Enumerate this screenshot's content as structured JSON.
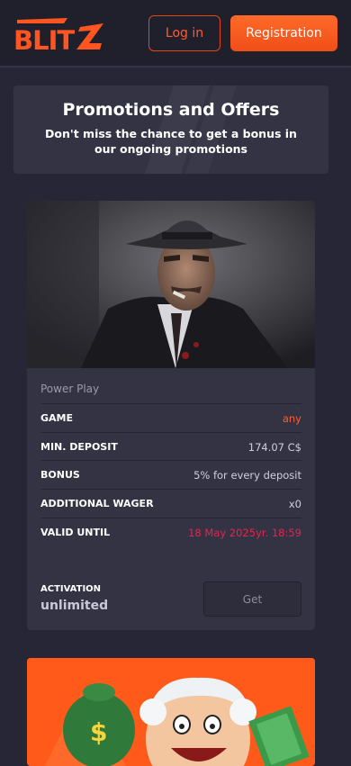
{
  "header": {
    "logo_text": "BLITZ",
    "login_label": "Log in",
    "register_label": "Registration"
  },
  "promotions": {
    "title": "Promotions and Offers",
    "subtitle": "Don't miss the chance to get a bonus in our ongoing promotions"
  },
  "offer": {
    "name": "Power Play",
    "rows": [
      {
        "label": "GAME",
        "value": "any"
      },
      {
        "label": "MIN. DEPOSIT",
        "value": "174.07 C$"
      },
      {
        "label": "BONUS",
        "value": "5% for every deposit"
      },
      {
        "label": "ADDITIONAL WAGER",
        "value": "x0"
      },
      {
        "label": "VALID UNTIL",
        "value": "18 May 2025yr. 18:59"
      }
    ],
    "activation_label": "ACTIVATION",
    "activation_value": "unlimited",
    "get_label": "Get"
  },
  "colors": {
    "accent": "#ff5d2b",
    "background": "#262636",
    "card": "#333344",
    "date_red": "#e2264f"
  }
}
